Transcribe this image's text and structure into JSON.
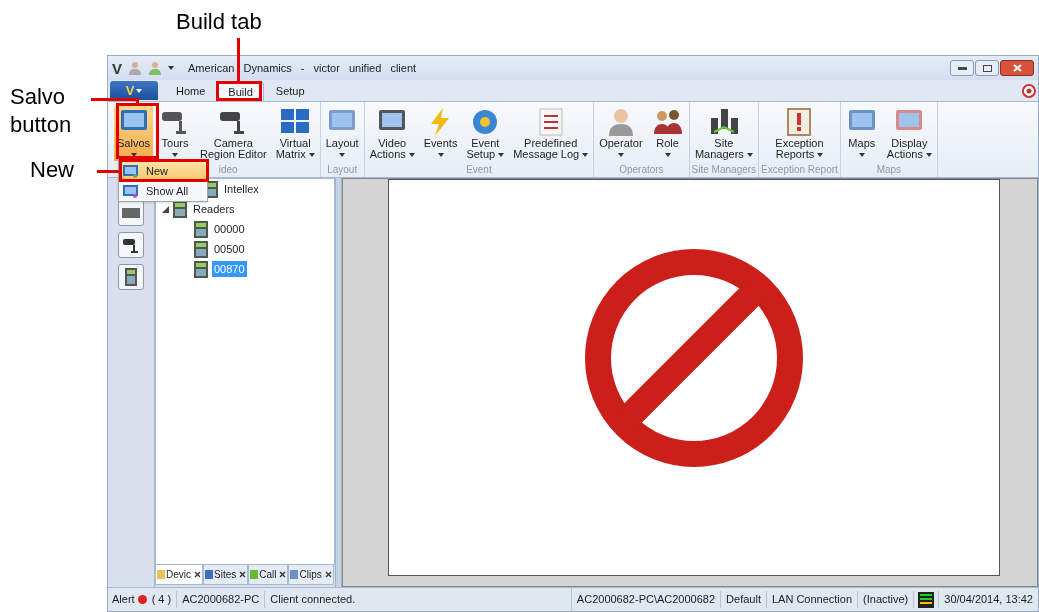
{
  "callouts": {
    "build_tab": "Build tab",
    "salvo_button": [
      "Salvo",
      "button"
    ],
    "new_item": "New"
  },
  "quick_access": {
    "logo": "V"
  },
  "window": {
    "title": "American Dynamics - victor unified client"
  },
  "app_menu": {
    "label": "V"
  },
  "tabs": [
    {
      "label": "Home",
      "selected": false
    },
    {
      "label": "Build",
      "selected": true
    },
    {
      "label": "Setup",
      "selected": false
    }
  ],
  "ribbon": [
    {
      "group": "ideo",
      "items": [
        {
          "lines": [
            "Salvos"
          ],
          "kind": "split",
          "selected": true
        },
        {
          "lines": [
            "Tours"
          ],
          "kind": "split",
          "selected": false
        },
        {
          "lines": [
            "Camera",
            "Region Editor"
          ],
          "kind": "plain",
          "selected": false
        },
        {
          "lines": [
            "Virtual",
            "Matrix"
          ],
          "kind": "menu",
          "selected": false
        }
      ]
    },
    {
      "group": "Layout",
      "items": [
        {
          "lines": [
            "Layout"
          ],
          "kind": "split",
          "selected": false
        }
      ]
    },
    {
      "group": "Event",
      "items": [
        {
          "lines": [
            "Video",
            "Actions"
          ],
          "kind": "menu",
          "selected": false
        },
        {
          "lines": [
            "Events"
          ],
          "kind": "split",
          "selected": false
        },
        {
          "lines": [
            "Event",
            "Setup"
          ],
          "kind": "menu",
          "selected": false
        },
        {
          "lines": [
            "Predefined",
            "Message Log"
          ],
          "kind": "menu",
          "selected": false
        }
      ]
    },
    {
      "group": "Operators",
      "items": [
        {
          "lines": [
            "Operator"
          ],
          "kind": "split",
          "selected": false
        },
        {
          "lines": [
            "Role"
          ],
          "kind": "split",
          "selected": false
        }
      ]
    },
    {
      "group": "Site Managers",
      "items": [
        {
          "lines": [
            "Site",
            "Managers"
          ],
          "kind": "menu",
          "selected": false
        }
      ]
    },
    {
      "group": "Exception Report",
      "items": [
        {
          "lines": [
            "Exception",
            "Reports"
          ],
          "kind": "menu",
          "selected": false
        }
      ]
    },
    {
      "group": "Maps",
      "items": [
        {
          "lines": [
            "Maps"
          ],
          "kind": "split",
          "selected": false
        },
        {
          "lines": [
            "Display",
            "Actions"
          ],
          "kind": "menu",
          "selected": false
        }
      ]
    }
  ],
  "dropdown_menu": [
    {
      "label": "New",
      "selected": true
    },
    {
      "label": "Show All",
      "selected": false
    }
  ],
  "tree": [
    {
      "label": "Intellex",
      "selected": false
    },
    {
      "label": "Readers",
      "selected": false,
      "expanded": true,
      "children": [
        {
          "label": "00000",
          "selected": false
        },
        {
          "label": "00500",
          "selected": false
        },
        {
          "label": "00870",
          "selected": true
        }
      ]
    }
  ],
  "panel_tabs": [
    {
      "label": "Devic",
      "selected": true
    },
    {
      "label": "Sites",
      "selected": false
    },
    {
      "label": "Call",
      "selected": false
    },
    {
      "label": "Clips",
      "selected": false
    }
  ],
  "status_bar": {
    "alert_label": "Alert",
    "alert_count": "( 4 )",
    "machine": "AC2000682-PC",
    "message": "Client connected.",
    "user": "AC2000682-PC\\AC2000682",
    "profile": "Default",
    "connection": "LAN Connection",
    "state": "(Inactive)",
    "datetime": "30/04/2014, 13:42"
  }
}
